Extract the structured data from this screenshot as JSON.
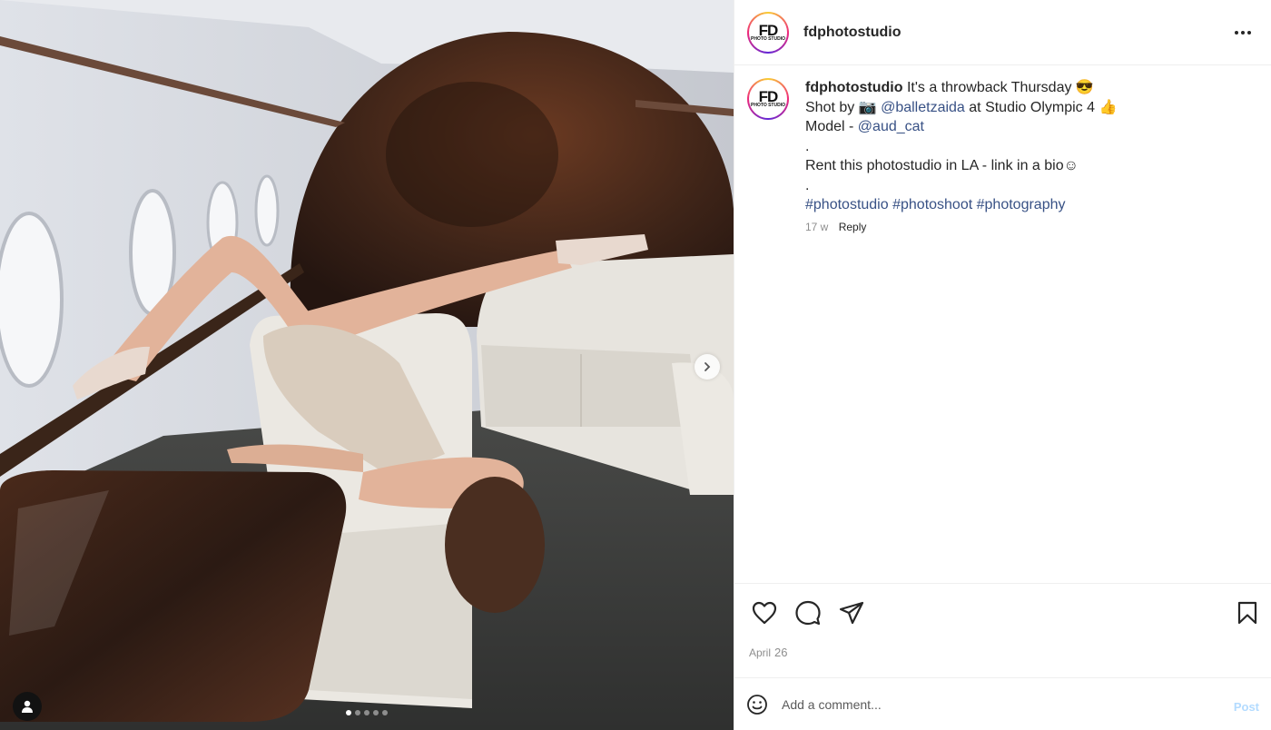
{
  "post": {
    "username": "fdphotostudio",
    "avatar_text": "FD",
    "avatar_subtext": "PHOTO STUDIO",
    "more_icon": "more-horizontal-icon",
    "image_count": 5,
    "active_image_index": 0
  },
  "caption": {
    "username": "fdphotostudio",
    "line1_text": " It's a throwback Thursday 😎",
    "line2_prefix": "Shot by 📷 ",
    "line2_link": "@balletzaida",
    "line2_suffix": " at Studio Olympic 4 👍",
    "line3_prefix": "Model - ",
    "line3_link": "@aud_cat",
    "dot1": ".",
    "line4": "Rent this photostudio in LA - link in a bio☺",
    "dot2": ".",
    "hashtags": [
      "#photostudio",
      "#photoshoot",
      "#photography"
    ],
    "age": "17 w",
    "reply_label": "Reply"
  },
  "footer": {
    "date_month": "April",
    "date_day": "26",
    "comment_placeholder": "Add a comment...",
    "post_label": "Post"
  },
  "colors": {
    "link": "#385185",
    "text": "#262626",
    "muted": "#8e8e8e",
    "post_disabled": "#b3dbff"
  }
}
